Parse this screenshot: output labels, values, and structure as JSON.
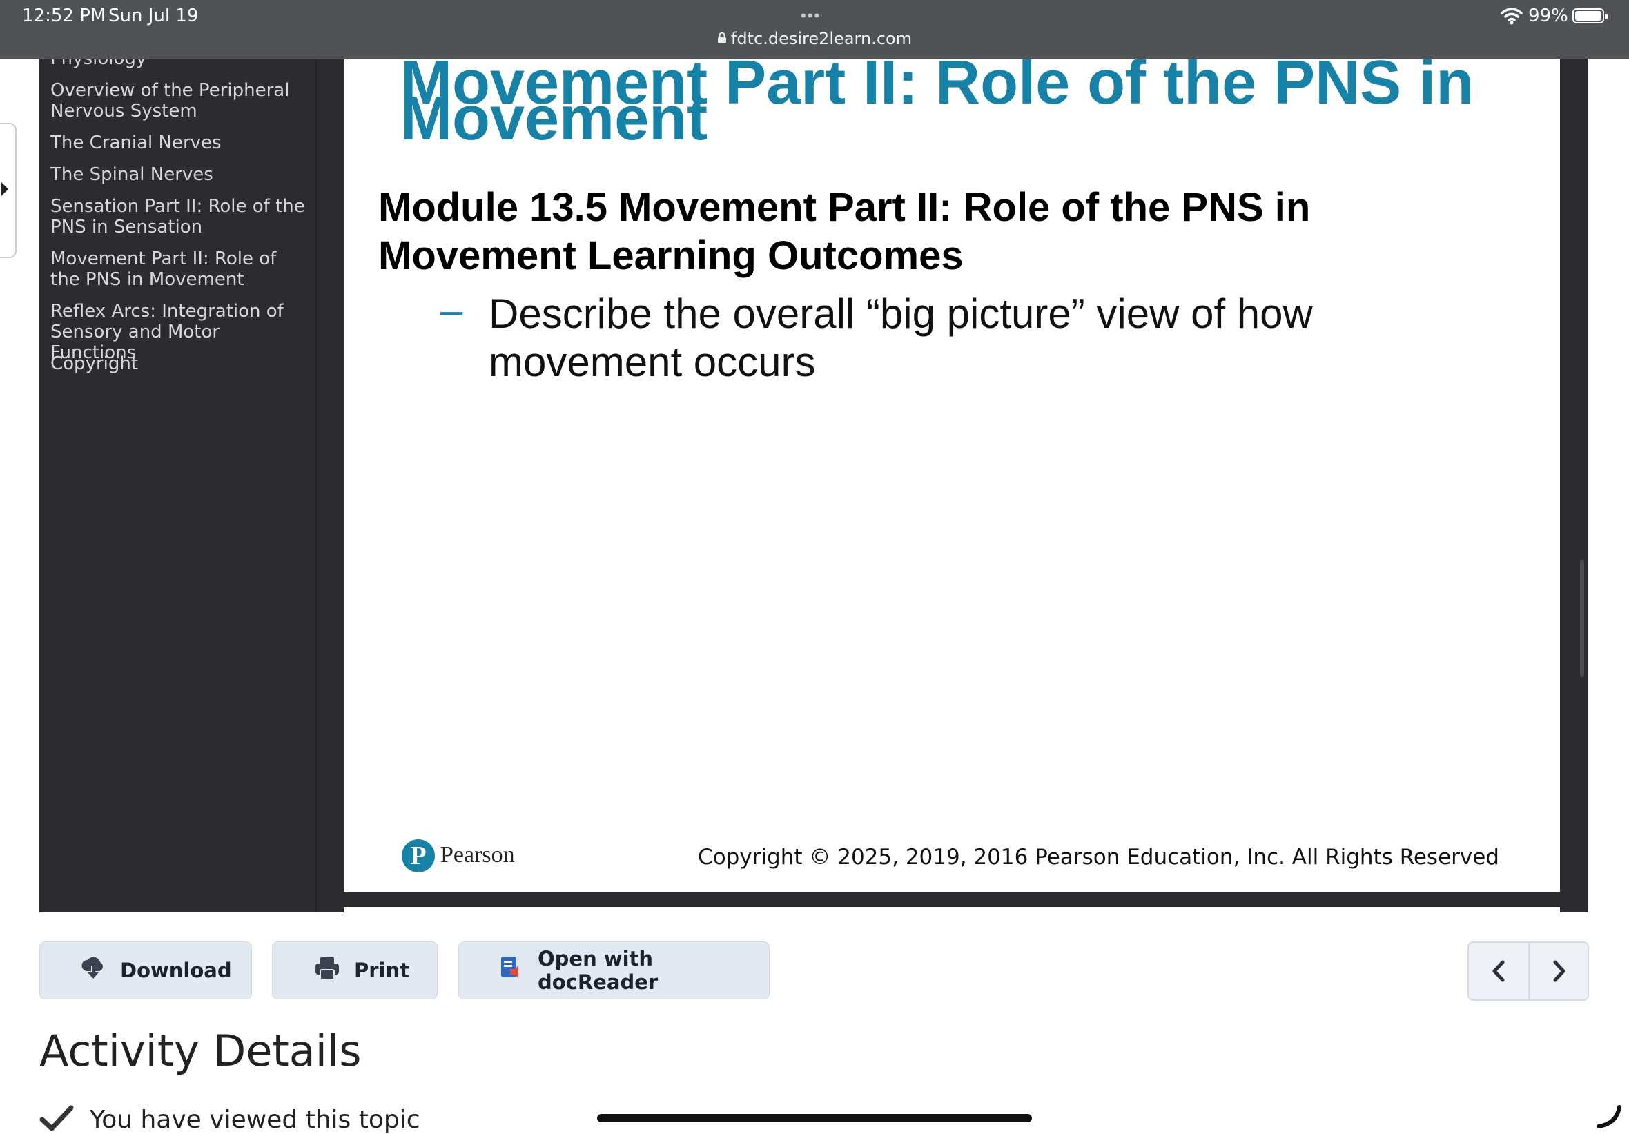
{
  "status_bar": {
    "time": "12:52 PM",
    "date": "Sun Jul 19",
    "dots": "•••",
    "lock_icon": "lock-icon",
    "url": "fdtc.desire2learn.com",
    "battery_percent": "99%",
    "battery_level": 0.99
  },
  "toc": {
    "items": [
      {
        "label": "Physiology"
      },
      {
        "label": "Overview of the Peripheral Nervous System"
      },
      {
        "label": "The Cranial Nerves"
      },
      {
        "label": "The Spinal Nerves"
      },
      {
        "label": "Sensation Part II: Role of the PNS in Sensation"
      },
      {
        "label": "Movement Part II: Role of the PNS in Movement"
      },
      {
        "label": "Reflex Arcs: Integration of Sensory and Motor Functions"
      },
      {
        "label": "Copyright"
      }
    ]
  },
  "slide": {
    "title_clipped": "Movement Part II: Role of the PNS in",
    "title": "Movement",
    "heading": "Module 13.5 Movement Part II: Role of the PNS in Movement Learning Outcomes",
    "dash": "–",
    "bullet": "Describe the overall “big picture” view of how movement occurs",
    "logo_letter": "P",
    "publisher": "Pearson",
    "copyright": "Copyright © 2025, 2019, 2016 Pearson Education, Inc. All Rights Reserved"
  },
  "actions": {
    "download_label": "Download",
    "print_label": "Print",
    "docreader_label": "Open with docReader"
  },
  "activity": {
    "title": "Activity Details",
    "viewed_text": "You have viewed this topic"
  },
  "colors": {
    "accent": "#1782a8",
    "viewer_bg": "#2c2c30",
    "button_bg": "#e3e9f1"
  }
}
